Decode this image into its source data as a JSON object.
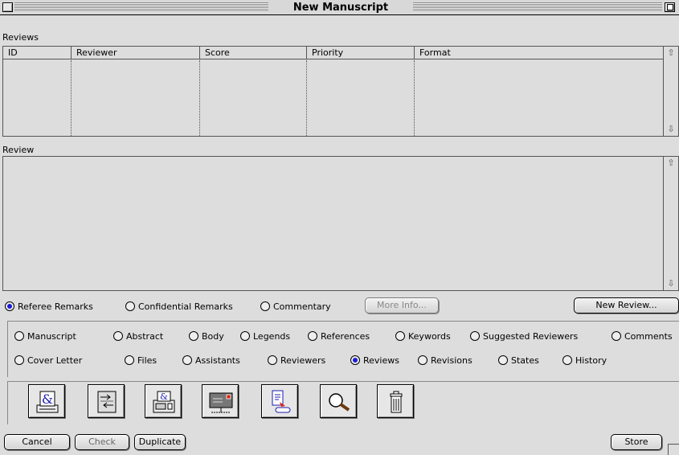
{
  "window": {
    "title": "New Manuscript"
  },
  "reviews_section": {
    "label": "Reviews",
    "columns": [
      "ID",
      "Reviewer",
      "Score",
      "Priority",
      "Format"
    ],
    "rows": []
  },
  "review_section": {
    "label": "Review",
    "text": ""
  },
  "remark_types": [
    {
      "label": "Referee Remarks",
      "selected": true
    },
    {
      "label": "Confidential Remarks",
      "selected": false
    },
    {
      "label": "Commentary",
      "selected": false
    }
  ],
  "buttons": {
    "more_info": "More Info...",
    "new_review": "New Review...",
    "cancel": "Cancel",
    "check": "Check",
    "duplicate": "Duplicate",
    "store": "Store"
  },
  "sections_row1": [
    {
      "label": "Manuscript",
      "selected": false
    },
    {
      "label": "Abstract",
      "selected": false
    },
    {
      "label": "Body",
      "selected": false
    },
    {
      "label": "Legends",
      "selected": false
    },
    {
      "label": "References",
      "selected": false
    },
    {
      "label": "Keywords",
      "selected": false
    },
    {
      "label": "Suggested Reviewers",
      "selected": false
    },
    {
      "label": "Comments",
      "selected": false
    }
  ],
  "sections_row2": [
    {
      "label": "Cover Letter",
      "selected": false
    },
    {
      "label": "Files",
      "selected": false
    },
    {
      "label": "Assistants",
      "selected": false
    },
    {
      "label": "Reviewers",
      "selected": false
    },
    {
      "label": "Reviews",
      "selected": true
    },
    {
      "label": "Revisions",
      "selected": false
    },
    {
      "label": "States",
      "selected": false
    },
    {
      "label": "History",
      "selected": false
    }
  ],
  "toolbar_icons": [
    "letter-print-icon",
    "transfer-icon",
    "fax-print-icon",
    "mail-icon",
    "document-export-icon",
    "magnifier-icon",
    "trash-icon"
  ],
  "colors": {
    "background": "#dddddd",
    "radio_selected": "#1b1bd8"
  }
}
